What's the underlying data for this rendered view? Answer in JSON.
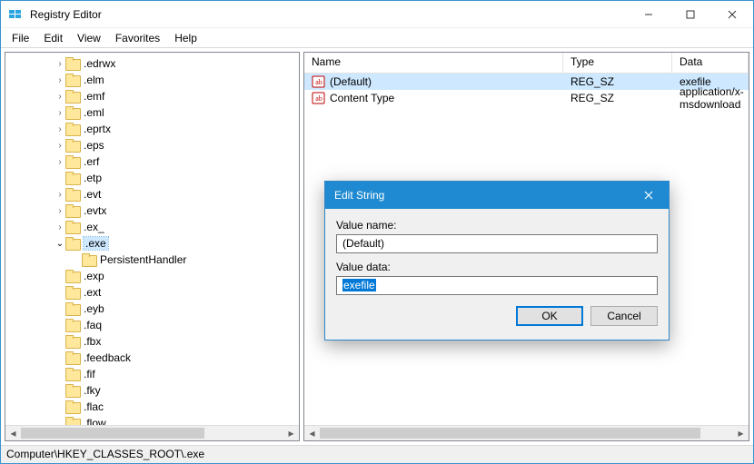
{
  "window": {
    "title": "Registry Editor"
  },
  "titlebar_tooltips": {
    "min": "Minimize",
    "max": "Maximize",
    "close": "Close"
  },
  "menu": {
    "file": "File",
    "edit": "Edit",
    "view": "View",
    "favorites": "Favorites",
    "help": "Help"
  },
  "tree": {
    "items": [
      {
        "label": ".edrwx",
        "depth": 3,
        "twisty": ">"
      },
      {
        "label": ".elm",
        "depth": 3,
        "twisty": ">"
      },
      {
        "label": ".emf",
        "depth": 3,
        "twisty": ">"
      },
      {
        "label": ".eml",
        "depth": 3,
        "twisty": ">"
      },
      {
        "label": ".eprtx",
        "depth": 3,
        "twisty": ">"
      },
      {
        "label": ".eps",
        "depth": 3,
        "twisty": ">"
      },
      {
        "label": ".erf",
        "depth": 3,
        "twisty": ">"
      },
      {
        "label": ".etp",
        "depth": 3,
        "twisty": ""
      },
      {
        "label": ".evt",
        "depth": 3,
        "twisty": ">"
      },
      {
        "label": ".evtx",
        "depth": 3,
        "twisty": ">"
      },
      {
        "label": ".ex_",
        "depth": 3,
        "twisty": ">"
      },
      {
        "label": ".exe",
        "depth": 3,
        "twisty": "v",
        "selected": true
      },
      {
        "label": "PersistentHandler",
        "depth": 4,
        "twisty": ""
      },
      {
        "label": ".exp",
        "depth": 3,
        "twisty": ""
      },
      {
        "label": ".ext",
        "depth": 3,
        "twisty": ""
      },
      {
        "label": ".eyb",
        "depth": 3,
        "twisty": ""
      },
      {
        "label": ".faq",
        "depth": 3,
        "twisty": ""
      },
      {
        "label": ".fbx",
        "depth": 3,
        "twisty": ""
      },
      {
        "label": ".feedback",
        "depth": 3,
        "twisty": ""
      },
      {
        "label": ".fif",
        "depth": 3,
        "twisty": ""
      },
      {
        "label": ".fky",
        "depth": 3,
        "twisty": ""
      },
      {
        "label": ".flac",
        "depth": 3,
        "twisty": ""
      },
      {
        "label": ".flow",
        "depth": 3,
        "twisty": ""
      }
    ]
  },
  "list": {
    "columns": {
      "name": "Name",
      "type": "Type",
      "data": "Data"
    },
    "rows": [
      {
        "name": "(Default)",
        "type": "REG_SZ",
        "data": "exefile",
        "selected": true
      },
      {
        "name": "Content Type",
        "type": "REG_SZ",
        "data": "application/x-msdownload"
      }
    ]
  },
  "statusbar": {
    "path": "Computer\\HKEY_CLASSES_ROOT\\.exe"
  },
  "dialog": {
    "title": "Edit String",
    "value_name_label": "Value name:",
    "value_name": "(Default)",
    "value_data_label": "Value data:",
    "value_data": "exefile",
    "ok": "OK",
    "cancel": "Cancel"
  }
}
